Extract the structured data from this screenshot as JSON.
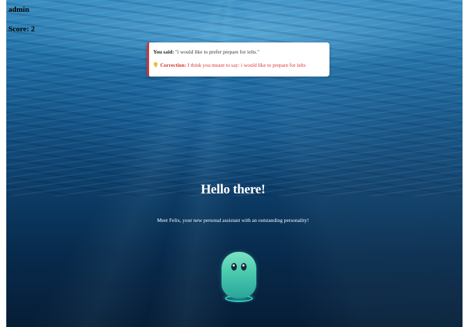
{
  "user": {
    "name": "admin",
    "score_text": "Score: 2"
  },
  "feedback": {
    "said_label": "You said:",
    "said_text": " \"i would like to prefer prepare for ielts.\"",
    "correction_label": "Correction:",
    "correction_text": " I think you meant to say: i would like to prepare for ielts",
    "icon": "lightbulb-icon",
    "accent_color": "#d9312b"
  },
  "hero": {
    "title": "Hello there!",
    "subtitle": "Meet Felix, your new personal assistant with an outstanding personality!"
  },
  "assistant": {
    "avatar": "felix-mascot",
    "color": "#4ecdb0"
  }
}
